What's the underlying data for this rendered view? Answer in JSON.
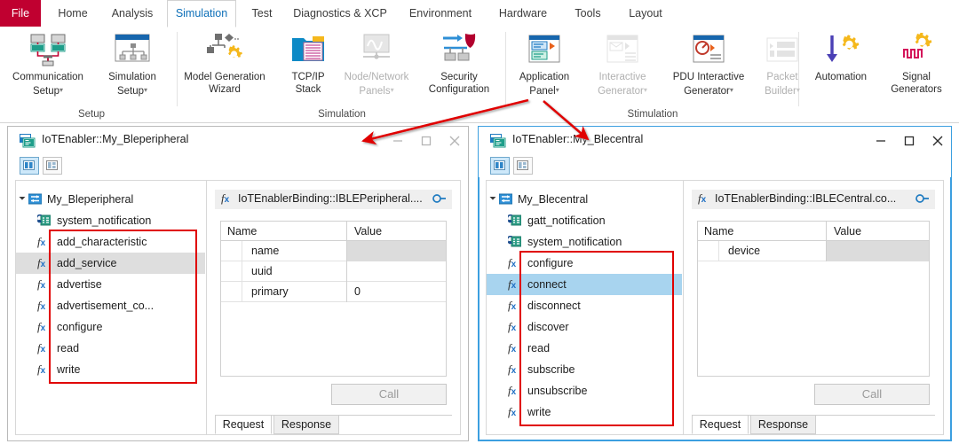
{
  "ribbon": {
    "tabs": [
      {
        "label": "File",
        "state": "file"
      },
      {
        "label": "Home",
        "state": "normal"
      },
      {
        "label": "Analysis",
        "state": "normal"
      },
      {
        "label": "Simulation",
        "state": "active"
      },
      {
        "label": "Test",
        "state": "normal"
      },
      {
        "label": "Diagnostics & XCP",
        "state": "normal"
      },
      {
        "label": "Environment",
        "state": "normal"
      },
      {
        "label": "Hardware",
        "state": "normal"
      },
      {
        "label": "Tools",
        "state": "normal"
      },
      {
        "label": "Layout",
        "state": "normal"
      }
    ],
    "groups": [
      {
        "label": "Setup"
      },
      {
        "label": "Simulation"
      },
      {
        "label": "Stimulation"
      },
      {
        "label": ""
      }
    ],
    "commands": [
      {
        "label": "Communication\nSetup",
        "icon": "communication-setup-icon",
        "dropdown": true,
        "disabled": false
      },
      {
        "label": "Simulation\nSetup",
        "icon": "simulation-setup-icon",
        "dropdown": true,
        "disabled": false
      },
      {
        "label": "Model Generation\nWizard",
        "icon": "model-generation-wizard-icon",
        "dropdown": false,
        "disabled": false
      },
      {
        "label": "TCP/IP\nStack",
        "icon": "tcpip-stack-icon",
        "dropdown": false,
        "disabled": false
      },
      {
        "label": "Node/Network\nPanels",
        "icon": "node-network-panels-icon",
        "dropdown": true,
        "disabled": true
      },
      {
        "label": "Security\nConfiguration",
        "icon": "security-configuration-icon",
        "dropdown": false,
        "disabled": false
      },
      {
        "label": "Application\nPanel",
        "icon": "application-panel-icon",
        "dropdown": true,
        "disabled": false
      },
      {
        "label": "Interactive\nGenerator",
        "icon": "interactive-generator-icon",
        "dropdown": true,
        "disabled": true
      },
      {
        "label": "PDU Interactive\nGenerator",
        "icon": "pdu-interactive-generator-icon",
        "dropdown": true,
        "disabled": false
      },
      {
        "label": "Packet\nBuilder",
        "icon": "packet-builder-icon",
        "dropdown": true,
        "disabled": true
      },
      {
        "label": "Automation",
        "icon": "automation-icon",
        "dropdown": false,
        "disabled": false
      },
      {
        "label": "Signal\nGenerators",
        "icon": "signal-generators-icon",
        "dropdown": false,
        "disabled": false
      }
    ]
  },
  "windows": [
    {
      "title": "IoTEnabler::My_Bleperipheral",
      "active": false,
      "toolbar": [
        {
          "icon": "two-column-layout-icon",
          "selected": true
        },
        {
          "icon": "split-layout-icon",
          "selected": false
        }
      ],
      "tree": {
        "root": {
          "label": "My_Bleperipheral",
          "icon": "node-icon",
          "expanded": true
        },
        "items": [
          {
            "label": "system_notification",
            "icon": "notification-icon",
            "type": "notification",
            "selected": "none"
          },
          {
            "label": "add_characteristic",
            "icon": "function-icon",
            "type": "function",
            "selected": "none"
          },
          {
            "label": "add_service",
            "icon": "function-icon",
            "type": "function",
            "selected": "gray"
          },
          {
            "label": "advertise",
            "icon": "function-icon",
            "type": "function",
            "selected": "none"
          },
          {
            "label": "advertisement_co...",
            "icon": "function-icon",
            "type": "function",
            "selected": "none"
          },
          {
            "label": "configure",
            "icon": "function-icon",
            "type": "function",
            "selected": "none"
          },
          {
            "label": "read",
            "icon": "function-icon",
            "type": "function",
            "selected": "none"
          },
          {
            "label": "write",
            "icon": "function-icon",
            "type": "function",
            "selected": "none"
          }
        ]
      },
      "detail": {
        "binding": "IoTEnablerBinding::IBLEPeripheral....",
        "columns": [
          "Name",
          "Value"
        ],
        "rows": [
          {
            "name": "name",
            "value": "",
            "shaded": true
          },
          {
            "name": "uuid",
            "value": "",
            "shaded": false
          },
          {
            "name": "primary",
            "value": "0",
            "shaded": false
          }
        ],
        "call_button": "Call",
        "tabs": [
          {
            "label": "Request",
            "active": true
          },
          {
            "label": "Response",
            "active": false
          }
        ]
      }
    },
    {
      "title": "IoTEnabler::My_Blecentral",
      "active": true,
      "toolbar": [
        {
          "icon": "two-column-layout-icon",
          "selected": true
        },
        {
          "icon": "split-layout-icon",
          "selected": false
        }
      ],
      "tree": {
        "root": {
          "label": "My_Blecentral",
          "icon": "node-icon",
          "expanded": true
        },
        "items": [
          {
            "label": "gatt_notification",
            "icon": "notification-icon",
            "type": "notification",
            "selected": "none"
          },
          {
            "label": "system_notification",
            "icon": "notification-icon",
            "type": "notification",
            "selected": "none"
          },
          {
            "label": "configure",
            "icon": "function-icon",
            "type": "function",
            "selected": "none"
          },
          {
            "label": "connect",
            "icon": "function-icon",
            "type": "function",
            "selected": "blue"
          },
          {
            "label": "disconnect",
            "icon": "function-icon",
            "type": "function",
            "selected": "none"
          },
          {
            "label": "discover",
            "icon": "function-icon",
            "type": "function",
            "selected": "none"
          },
          {
            "label": "read",
            "icon": "function-icon",
            "type": "function",
            "selected": "none"
          },
          {
            "label": "subscribe",
            "icon": "function-icon",
            "type": "function",
            "selected": "none"
          },
          {
            "label": "unsubscribe",
            "icon": "function-icon",
            "type": "function",
            "selected": "none"
          },
          {
            "label": "write",
            "icon": "function-icon",
            "type": "function",
            "selected": "none"
          }
        ]
      },
      "detail": {
        "binding": "IoTEnablerBinding::IBLECentral.co...",
        "columns": [
          "Name",
          "Value"
        ],
        "rows": [
          {
            "name": "device",
            "value": "",
            "shaded": true
          }
        ],
        "call_button": "Call",
        "tabs": [
          {
            "label": "Request",
            "active": true
          },
          {
            "label": "Response",
            "active": false
          }
        ]
      }
    }
  ],
  "annotations": {
    "highlight_color": "#e00000",
    "arrow_color": "#e00000",
    "arrows": [
      {
        "name": "arrow-to-bleperipheral-window"
      },
      {
        "name": "arrow-to-blecentral-window"
      }
    ],
    "boxes": [
      {
        "name": "highlight-box-peripheral-functions"
      },
      {
        "name": "highlight-box-central-functions"
      }
    ]
  }
}
